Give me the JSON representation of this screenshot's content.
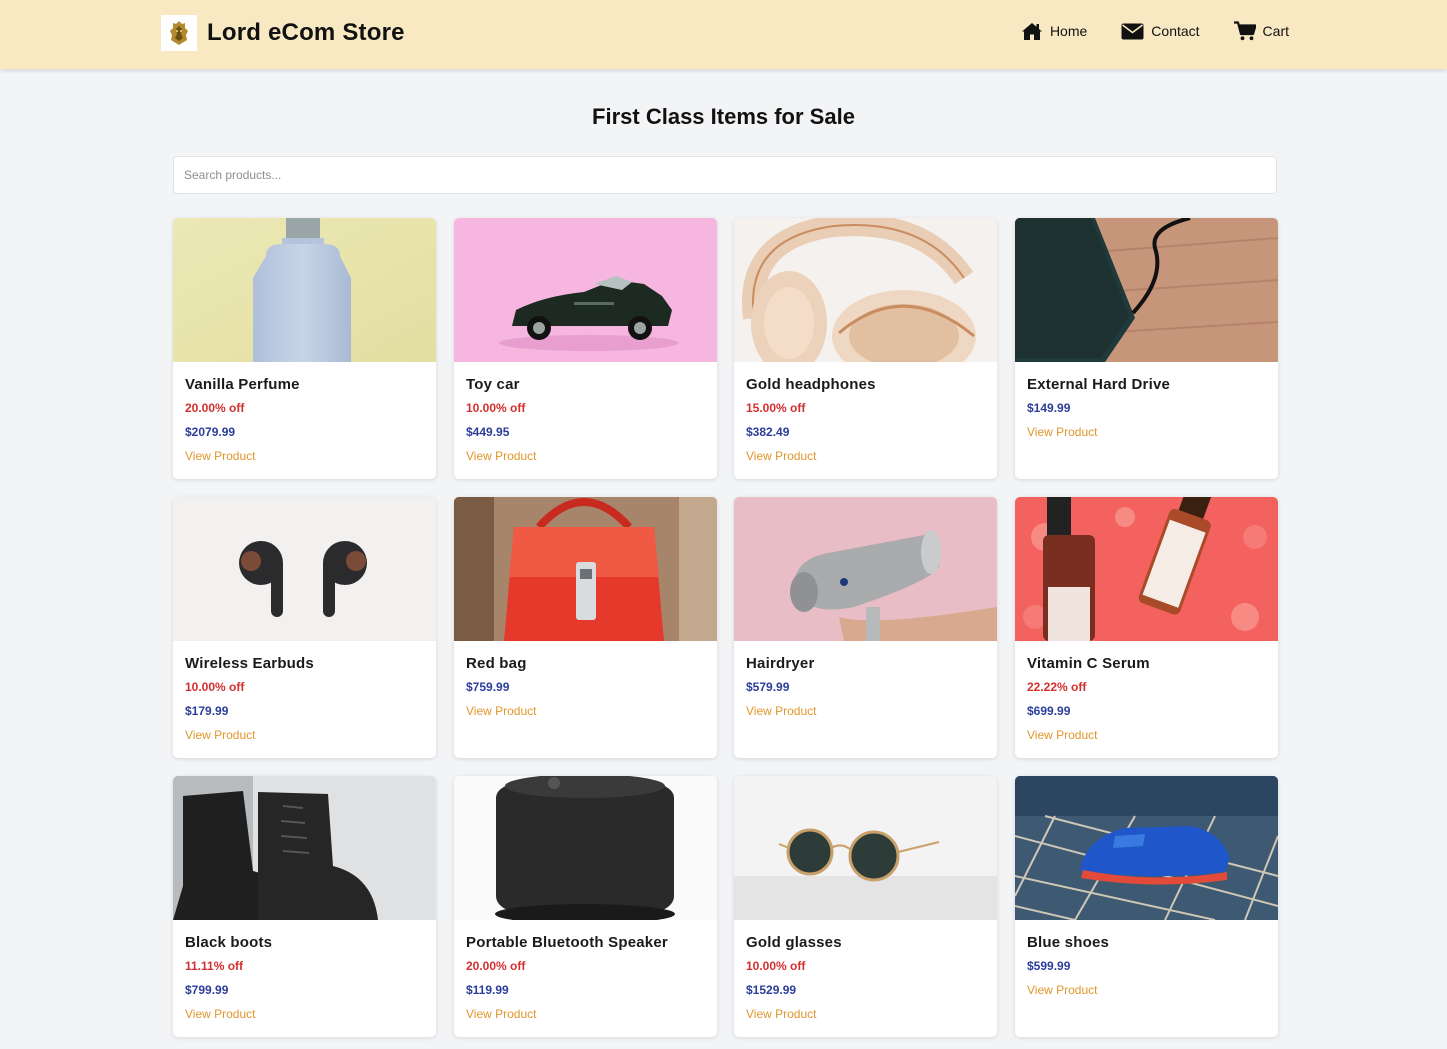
{
  "header": {
    "brand": "Lord eCom Store",
    "nav": [
      {
        "label": "Home",
        "icon": "home-icon"
      },
      {
        "label": "Contact",
        "icon": "envelope-icon"
      },
      {
        "label": "Cart",
        "icon": "cart-icon"
      }
    ]
  },
  "main": {
    "title": "First Class Items for Sale",
    "search_placeholder": "Search products..."
  },
  "colors": {
    "header_bg": "#f8e9c3",
    "discount": "#d32f2f",
    "price": "#2c3e9a",
    "link": "#e0962a"
  },
  "products": [
    {
      "name": "Vanilla Perfume",
      "discount": "20.00% off",
      "price": "$2079.99",
      "link": "View Product"
    },
    {
      "name": "Toy car",
      "discount": "10.00% off",
      "price": "$449.95",
      "link": "View Product"
    },
    {
      "name": "Gold headphones",
      "discount": "15.00% off",
      "price": "$382.49",
      "link": "View Product"
    },
    {
      "name": "External Hard Drive",
      "discount": "",
      "price": "$149.99",
      "link": "View Product"
    },
    {
      "name": "Wireless Earbuds",
      "discount": "10.00% off",
      "price": "$179.99",
      "link": "View Product"
    },
    {
      "name": "Red bag",
      "discount": "",
      "price": "$759.99",
      "link": "View Product"
    },
    {
      "name": "Hairdryer",
      "discount": "",
      "price": "$579.99",
      "link": "View Product"
    },
    {
      "name": "Vitamin C Serum",
      "discount": "22.22% off",
      "price": "$699.99",
      "link": "View Product"
    },
    {
      "name": "Black boots",
      "discount": "11.11% off",
      "price": "$799.99",
      "link": "View Product"
    },
    {
      "name": "Portable Bluetooth Speaker",
      "discount": "20.00% off",
      "price": "$119.99",
      "link": "View Product"
    },
    {
      "name": "Gold glasses",
      "discount": "10.00% off",
      "price": "$1529.99",
      "link": "View Product"
    },
    {
      "name": "Blue shoes",
      "discount": "",
      "price": "$599.99",
      "link": "View Product"
    }
  ]
}
